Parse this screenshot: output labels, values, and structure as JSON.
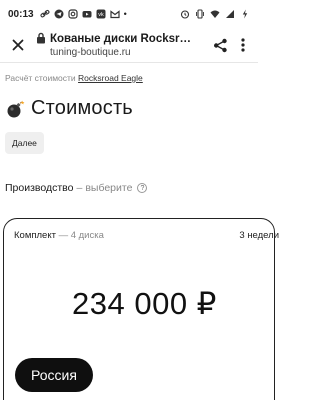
{
  "status_bar": {
    "time": "00:13"
  },
  "browser": {
    "page_title": "Кованые диски Rocksr…",
    "url": "tuning-boutique.ru"
  },
  "breadcrumb": {
    "prefix": "Расчёт стоимости",
    "link": "Rocksroad Eagle"
  },
  "heading": {
    "icon": "bomb-icon",
    "title": "Стоимость"
  },
  "next_button": {
    "label": "Далее"
  },
  "production": {
    "label": "Производство",
    "separator": "–",
    "placeholder": "выберите",
    "help": "?"
  },
  "card": {
    "set_label": "Комплект",
    "set_detail": "— 4 диска",
    "lead_time": "3 недели",
    "price": "234 000 ₽",
    "country_button": "Россия"
  }
}
